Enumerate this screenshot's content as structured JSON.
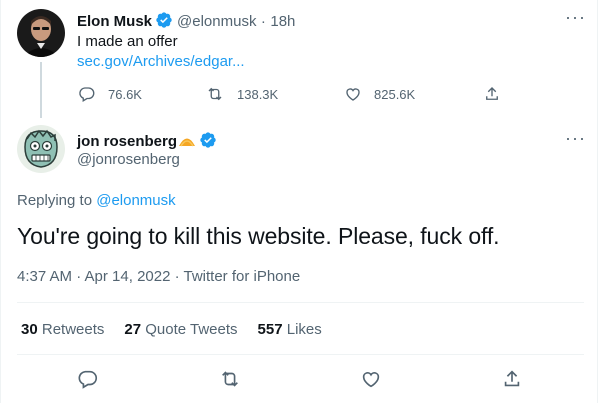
{
  "parent_tweet": {
    "name": "Elon Musk",
    "handle": "@elonmusk",
    "separator": "·",
    "time": "18h",
    "text": "I made an offer",
    "link": "sec.gov/Archives/edgar...",
    "replies": "76.6K",
    "retweets": "138.3K",
    "likes": "825.6K",
    "more": "···"
  },
  "main_tweet": {
    "name": "jon rosenberg",
    "handle": "@jonrosenberg",
    "replying_prefix": "Replying to",
    "replying_to": "@elonmusk",
    "text": "You're going to kill this website. Please, fuck off.",
    "timestamp": "4:37 AM · Apr 14, 2022 · Twitter for iPhone",
    "retweets_count": "30",
    "retweets_label": "Retweets",
    "quotes_count": "27",
    "quotes_label": "Quote Tweets",
    "likes_count": "557",
    "likes_label": "Likes",
    "more": "···"
  },
  "colors": {
    "accent": "#1d9bf0",
    "secondary_text": "#536471",
    "verified": "#1d9bf0"
  }
}
